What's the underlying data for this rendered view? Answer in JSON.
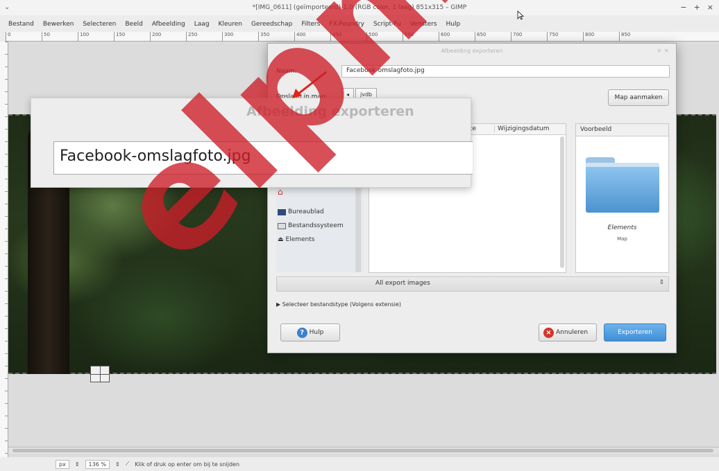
{
  "window": {
    "title": "*[IMG_0611] (geïmporteerd)-1.0 (RGB color, 1 laag) 851x315 – GIMP",
    "controls": [
      "−",
      "+",
      "×"
    ]
  },
  "menu": [
    "Bestand",
    "Bewerken",
    "Selecteren",
    "Beeld",
    "Afbeelding",
    "Laag",
    "Kleuren",
    "Gereedschap",
    "Filters",
    "FX-Foundry",
    "Script-Fu",
    "Vensters",
    "Hulp"
  ],
  "ruler_ticks": [
    "0",
    "50",
    "100",
    "150",
    "200",
    "250",
    "300",
    "350",
    "400",
    "450",
    "500",
    "550",
    "600",
    "650",
    "700",
    "750",
    "800",
    "850"
  ],
  "dialog": {
    "title": "Afbeelding exporteren",
    "name_label": "Naam:",
    "name_value": "Facebook-omslagfoto.jpg",
    "save_in_label": "Opslaan in map:",
    "path_buttons": [
      "◂",
      "jvdb"
    ],
    "create_folder_label": "Map aanmaken",
    "places": [
      "Bureaublad",
      "Bestandssysteem",
      "Elements"
    ],
    "col_size": "Grootte",
    "col_modified": "Wijzigingsdatum",
    "preview_header": "Voorbeeld",
    "preview_name": "Elements",
    "preview_type": "Map",
    "filter_value": "All export images",
    "filetype_expander": "Selecteer bestandstype (Volgens extensie)",
    "help_label": "Hulp",
    "cancel_label": "Annuleren",
    "export_label": "Exporteren"
  },
  "zoom_overlay": {
    "title": "Afbeelding exporteren",
    "name_value": "Facebook-omslagfoto.jpg"
  },
  "status": {
    "unit": "px",
    "zoom": "136 %",
    "message": "Klik of druk op enter om bij te snijden"
  },
  "watermark": "elpmij.nl"
}
